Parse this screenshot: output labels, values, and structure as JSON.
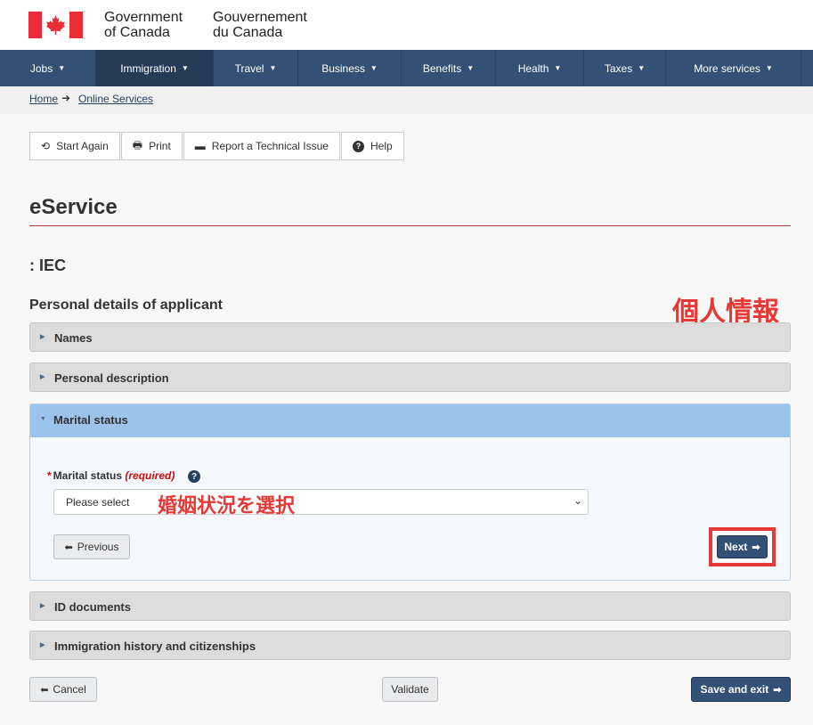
{
  "header": {
    "title_en_line1": "Government",
    "title_en_line2": "of Canada",
    "title_fr_line1": "Gouvernement",
    "title_fr_line2": "du Canada",
    "flag_color": "#eb2d37"
  },
  "nav": {
    "items": [
      "Jobs",
      "Immigration",
      "Travel",
      "Business",
      "Benefits",
      "Health",
      "Taxes",
      "More services"
    ],
    "active": "Immigration"
  },
  "breadcrumb": {
    "home": "Home",
    "online_services": "Online Services"
  },
  "toolbar": {
    "start_again": "Start Again",
    "print": "Print",
    "report": "Report a Technical Issue",
    "help": "Help"
  },
  "page": {
    "title": "eService",
    "subtitle": ": IEC",
    "section": "Personal details of applicant",
    "annotation_jp": "個人情報"
  },
  "accordion": {
    "names": "Names",
    "personal_description": "Personal description",
    "marital_status": "Marital status",
    "id_documents": "ID documents",
    "immigration_history": "Immigration history and citizenships"
  },
  "form": {
    "field_label": "Marital status",
    "required_text": "(required)",
    "select_value": "Please select",
    "select_annotation_jp": "婚姻状況を選択",
    "previous": "Previous",
    "next": "Next"
  },
  "footer": {
    "cancel": "Cancel",
    "validate": "Validate",
    "save_exit": "Save and exit"
  },
  "colors": {
    "nav_bg": "#335075",
    "accent_red": "#e53935",
    "open_header": "#9cc4ea"
  }
}
